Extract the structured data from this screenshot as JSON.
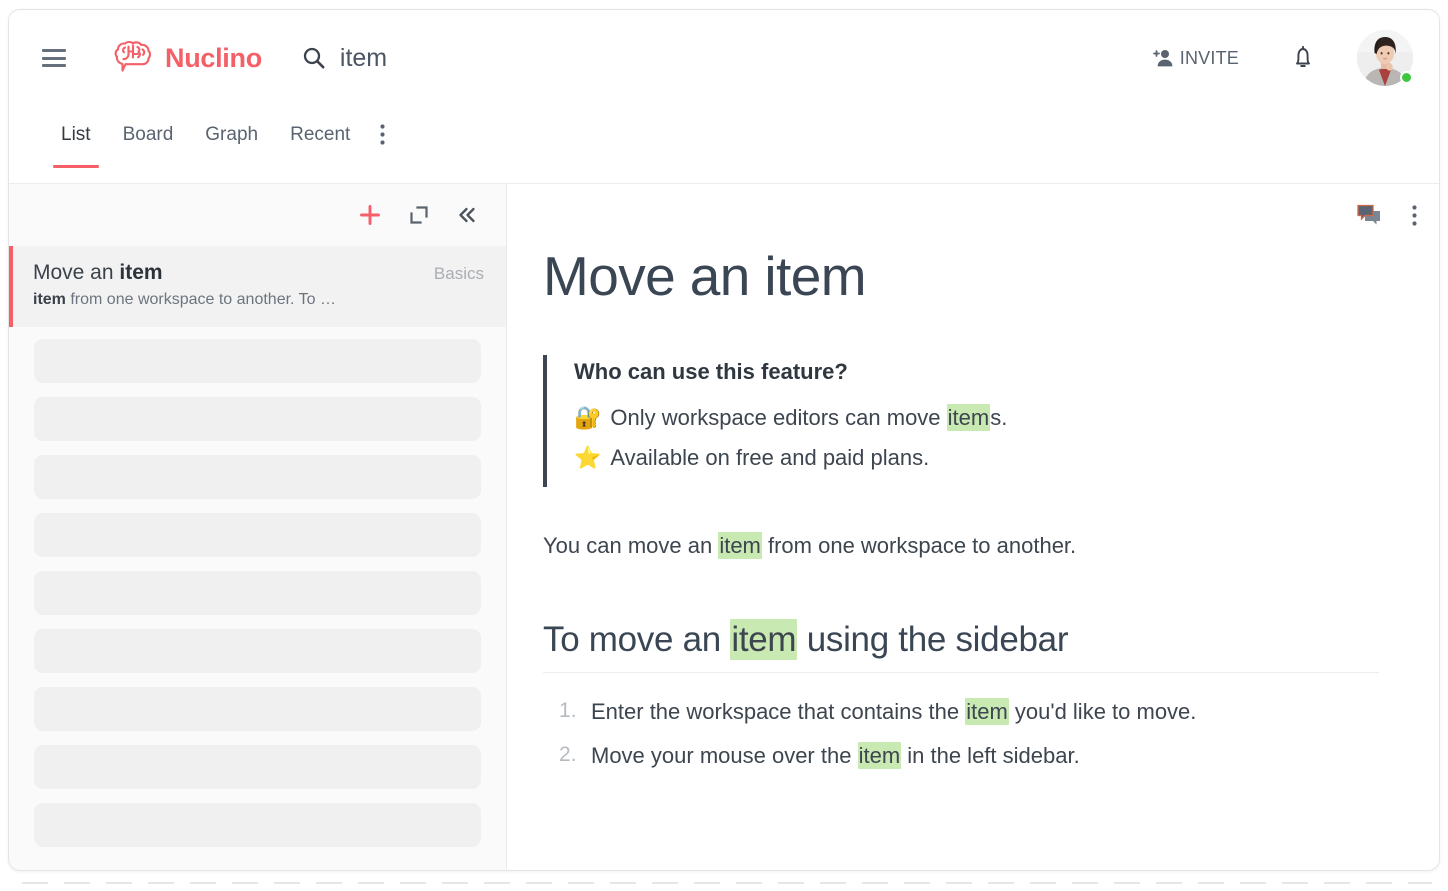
{
  "app": {
    "brand_name": "Nuclino",
    "brand_color": "#f45f68",
    "highlight_color": "#c9e9b3"
  },
  "topbar": {
    "menu_icon": "hamburger-menu-icon",
    "logo_icon": "nuclino-brain-logo-icon",
    "search": {
      "icon": "search-icon",
      "value": "item",
      "placeholder": "Search"
    },
    "invite": {
      "icon": "person-add-icon",
      "label": "INVITE"
    },
    "notifications_icon": "bell-icon",
    "avatar": {
      "name": "user-avatar",
      "status": "online",
      "status_color": "#3ec73e"
    }
  },
  "tabs": {
    "items": [
      {
        "label": "List",
        "active": true
      },
      {
        "label": "Board",
        "active": false
      },
      {
        "label": "Graph",
        "active": false
      },
      {
        "label": "Recent",
        "active": false
      }
    ],
    "more_icon": "more-vertical-icon"
  },
  "sidebar": {
    "toolbar": {
      "add_icon": "plus-icon",
      "expand_icon": "expand-fullscreen-icon",
      "collapse_icon": "collapse-left-double-chevron-icon"
    },
    "results": [
      {
        "title_prefix": "Move an ",
        "title_match": "item",
        "title_suffix": "",
        "tag": "Basics",
        "snippet_match": "item",
        "snippet_rest": " from one workspace to another. To …",
        "selected": true
      }
    ],
    "skeleton_rows": 9
  },
  "document": {
    "toolbar": {
      "comments_icon": "comment-bubble-icon",
      "more_icon": "more-vertical-icon"
    },
    "title": "Move an item",
    "callout": {
      "heading": "Who can use this feature?",
      "lines": [
        {
          "emoji": "🔐",
          "before": "Only workspace editors can move ",
          "highlight": "item",
          "after": "s."
        },
        {
          "emoji": "⭐",
          "before": "Available on free and paid plans.",
          "highlight": "",
          "after": ""
        }
      ]
    },
    "paragraph": {
      "before": "You can move an ",
      "highlight": "item",
      "after": " from one workspace to another."
    },
    "section_heading": {
      "before": "To move an ",
      "highlight": "item",
      "after": " using the sidebar"
    },
    "steps": [
      {
        "before": "Enter the workspace that contains the ",
        "highlight": "item",
        "after": " you'd like to move."
      },
      {
        "before": "Move your mouse over the ",
        "highlight": "item",
        "after": " in the left sidebar."
      }
    ]
  }
}
